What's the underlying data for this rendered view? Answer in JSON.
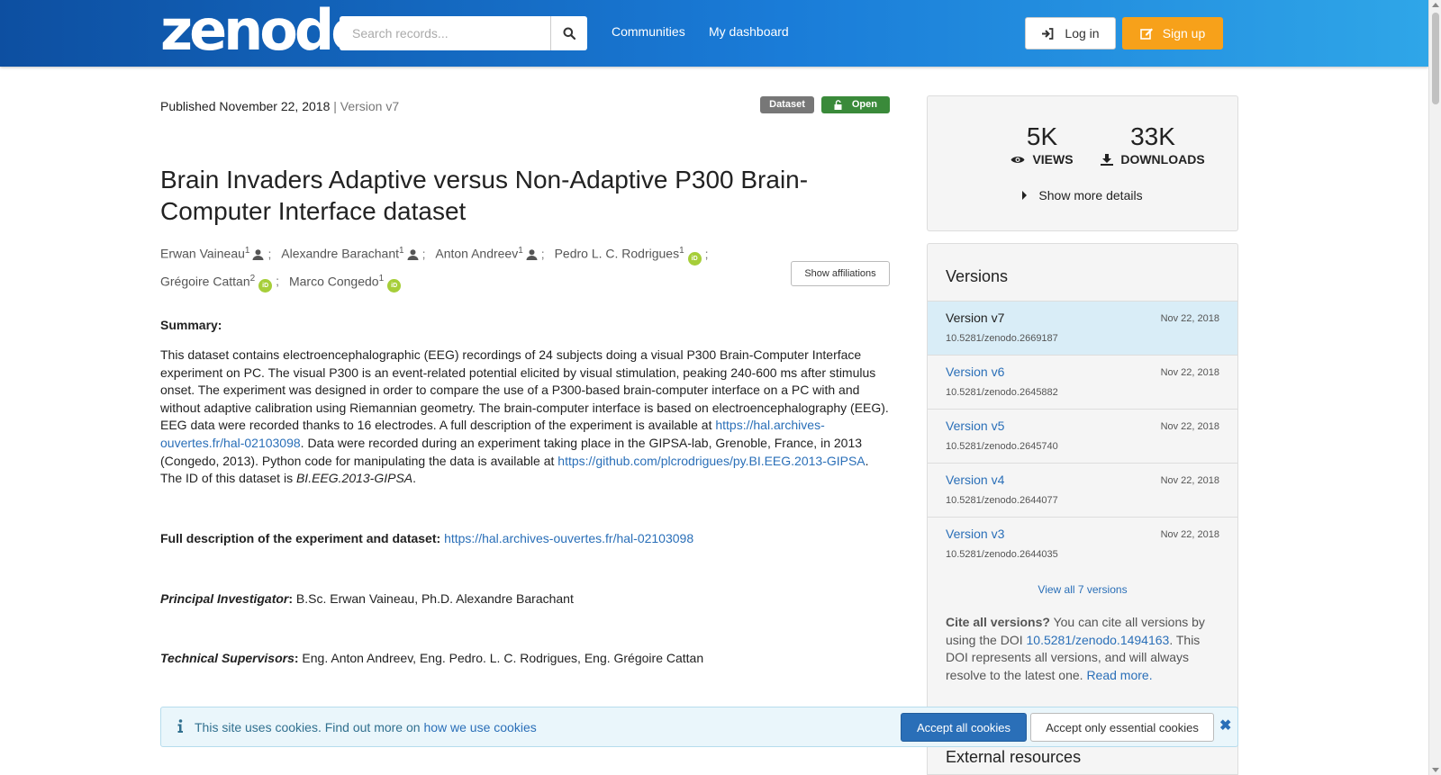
{
  "header": {
    "logo_text": "zenodo",
    "search_placeholder": "Search records...",
    "nav": [
      "Communities",
      "My dashboard"
    ],
    "login_label": "Log in",
    "signup_label": "Sign up",
    "accent_color": "#1a7cd8",
    "signup_color": "#f7a11a"
  },
  "record": {
    "published_label": "Published",
    "published_date": "November 22, 2018",
    "version_text": "| Version v7",
    "badge_type": "Dataset",
    "badge_access": "Open",
    "title": "Brain Invaders Adaptive versus Non-Adaptive P300 Brain-Computer Interface dataset",
    "authors": [
      {
        "name": "Erwan Vaineau",
        "aff": "1",
        "icon": "person-icon"
      },
      {
        "name": "Alexandre Barachant",
        "aff": "1",
        "icon": "person-icon"
      },
      {
        "name": "Anton Andreev",
        "aff": "1",
        "icon": "person-icon"
      },
      {
        "name": "Pedro L. C. Rodrigues",
        "aff": "1",
        "icon": "orcid-icon"
      },
      {
        "name": "Grégoire Cattan",
        "aff": "2",
        "icon": "orcid-icon"
      },
      {
        "name": "Marco Congedo",
        "aff": "1",
        "icon": "orcid-icon"
      }
    ],
    "show_affiliations_label": "Show affiliations",
    "summary_heading": "Summary:",
    "summary_p1": "This dataset contains electroencephalographic (EEG) recordings of 24 subjects doing a visual P300 Brain-Computer Interface experiment on PC. The visual P300 is an event-related potential elicited by visual stimulation, peaking 240-600 ms after stimulus onset. The experiment was designed in order to compare the use of a P300-based brain-computer interface on a PC with and without adaptive calibration using Riemannian geometry. The brain-computer interface is based on electroencephalography (EEG). EEG data were recorded thanks to 16 electrodes. A full description of the experiment is available at ",
    "summary_link1": "https://hal.archives-ouvertes.fr/hal-02103098",
    "summary_p2": ". Data were recorded during an experiment taking place in the GIPSA-lab, Grenoble, France, in 2013 (Congedo, 2013). Python code for manipulating the data is available at ",
    "summary_link2": "https://github.com/plcrodrigues/py.BI.EEG.2013-GIPSA",
    "summary_p3": ". The ID of this dataset is ",
    "dataset_id": "BI.EEG.2013-GIPSA",
    "summary_p4": ".",
    "full_desc_label": "Full description of the experiment and dataset:",
    "full_desc_link": "https://hal.archives-ouvertes.fr/hal-02103098",
    "pi_label": "Principal Investigator",
    "pi_value": " B.Sc. Erwan Vaineau, Ph.D. Alexandre Barachant",
    "ts_label": "Technical Supervisors",
    "ts_value": " Eng. Anton Andreev, Eng. Pedro. L. C. Rodrigues, Eng. Grégoire Cattan"
  },
  "stats": {
    "views_num": "5K",
    "views_label": "VIEWS",
    "downloads_num": "33K",
    "downloads_label": "DOWNLOADS",
    "show_more_label": "Show more details"
  },
  "versions": {
    "title": "Versions",
    "items": [
      {
        "name": "Version v7",
        "date": "Nov 22, 2018",
        "doi": "10.5281/zenodo.2669187",
        "active": true
      },
      {
        "name": "Version v6",
        "date": "Nov 22, 2018",
        "doi": "10.5281/zenodo.2645882",
        "active": false
      },
      {
        "name": "Version v5",
        "date": "Nov 22, 2018",
        "doi": "10.5281/zenodo.2645740",
        "active": false
      },
      {
        "name": "Version v4",
        "date": "Nov 22, 2018",
        "doi": "10.5281/zenodo.2644077",
        "active": false
      },
      {
        "name": "Version v3",
        "date": "Nov 22, 2018",
        "doi": "10.5281/zenodo.2644035",
        "active": false
      }
    ],
    "view_all_label": "View all 7 versions",
    "cite_bold": "Cite all versions?",
    "cite_text1": " You can cite all versions by using the DOI ",
    "cite_doi": "10.5281/zenodo.1494163",
    "cite_text2": ". This DOI represents all versions, and will always resolve to the latest one. ",
    "read_more": "Read more.",
    "external_resources": "External resources"
  },
  "cookie": {
    "text": "This site uses cookies. Find out more on ",
    "link": "how we use cookies",
    "accept_all": "Accept all cookies",
    "accept_essential": "Accept only essential cookies",
    "close_glyph": "✖"
  }
}
